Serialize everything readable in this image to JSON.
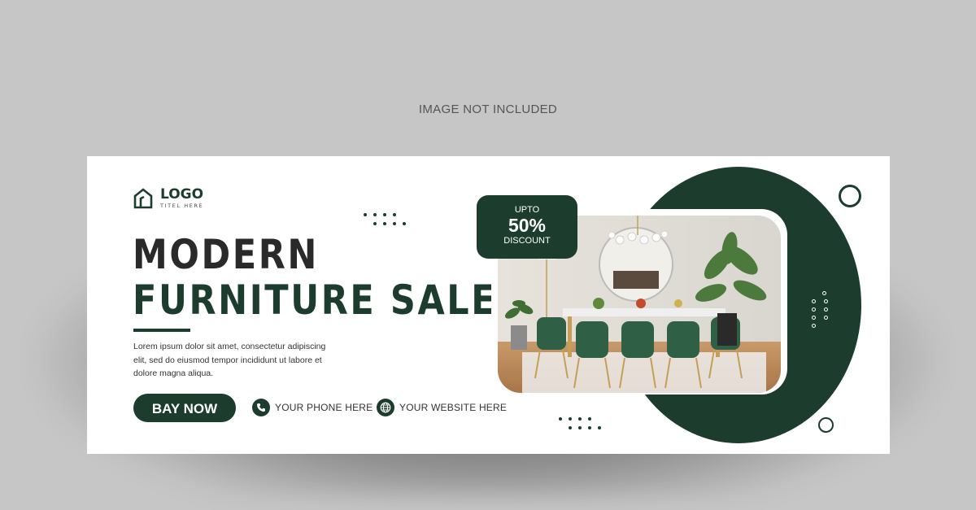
{
  "notice": "IMAGE NOT INCLUDED",
  "logo": {
    "name": "LOGO",
    "tagline": "TITEL HERE"
  },
  "headline": {
    "line1": "MODERN",
    "line2": "FURNITURE SALE"
  },
  "body_text": "Lorem ipsum dolor sit amet, consectetur adipiscing elit, sed do eiusmod tempor incididunt ut labore et dolore magna aliqua.",
  "cta": {
    "label": "BAY NOW"
  },
  "contacts": {
    "phone": "YOUR PHONE HERE",
    "website": "YOUR WEBSITE HERE"
  },
  "discount": {
    "prefix": "UPTO",
    "value": "50%",
    "suffix": "DISCOUNT"
  },
  "colors": {
    "accent": "#1c3d2d",
    "background": "#c6c6c6",
    "banner": "#ffffff",
    "headline_dark": "#2a2a2a"
  },
  "icons": [
    "house-icon",
    "phone-icon",
    "globe-icon"
  ]
}
